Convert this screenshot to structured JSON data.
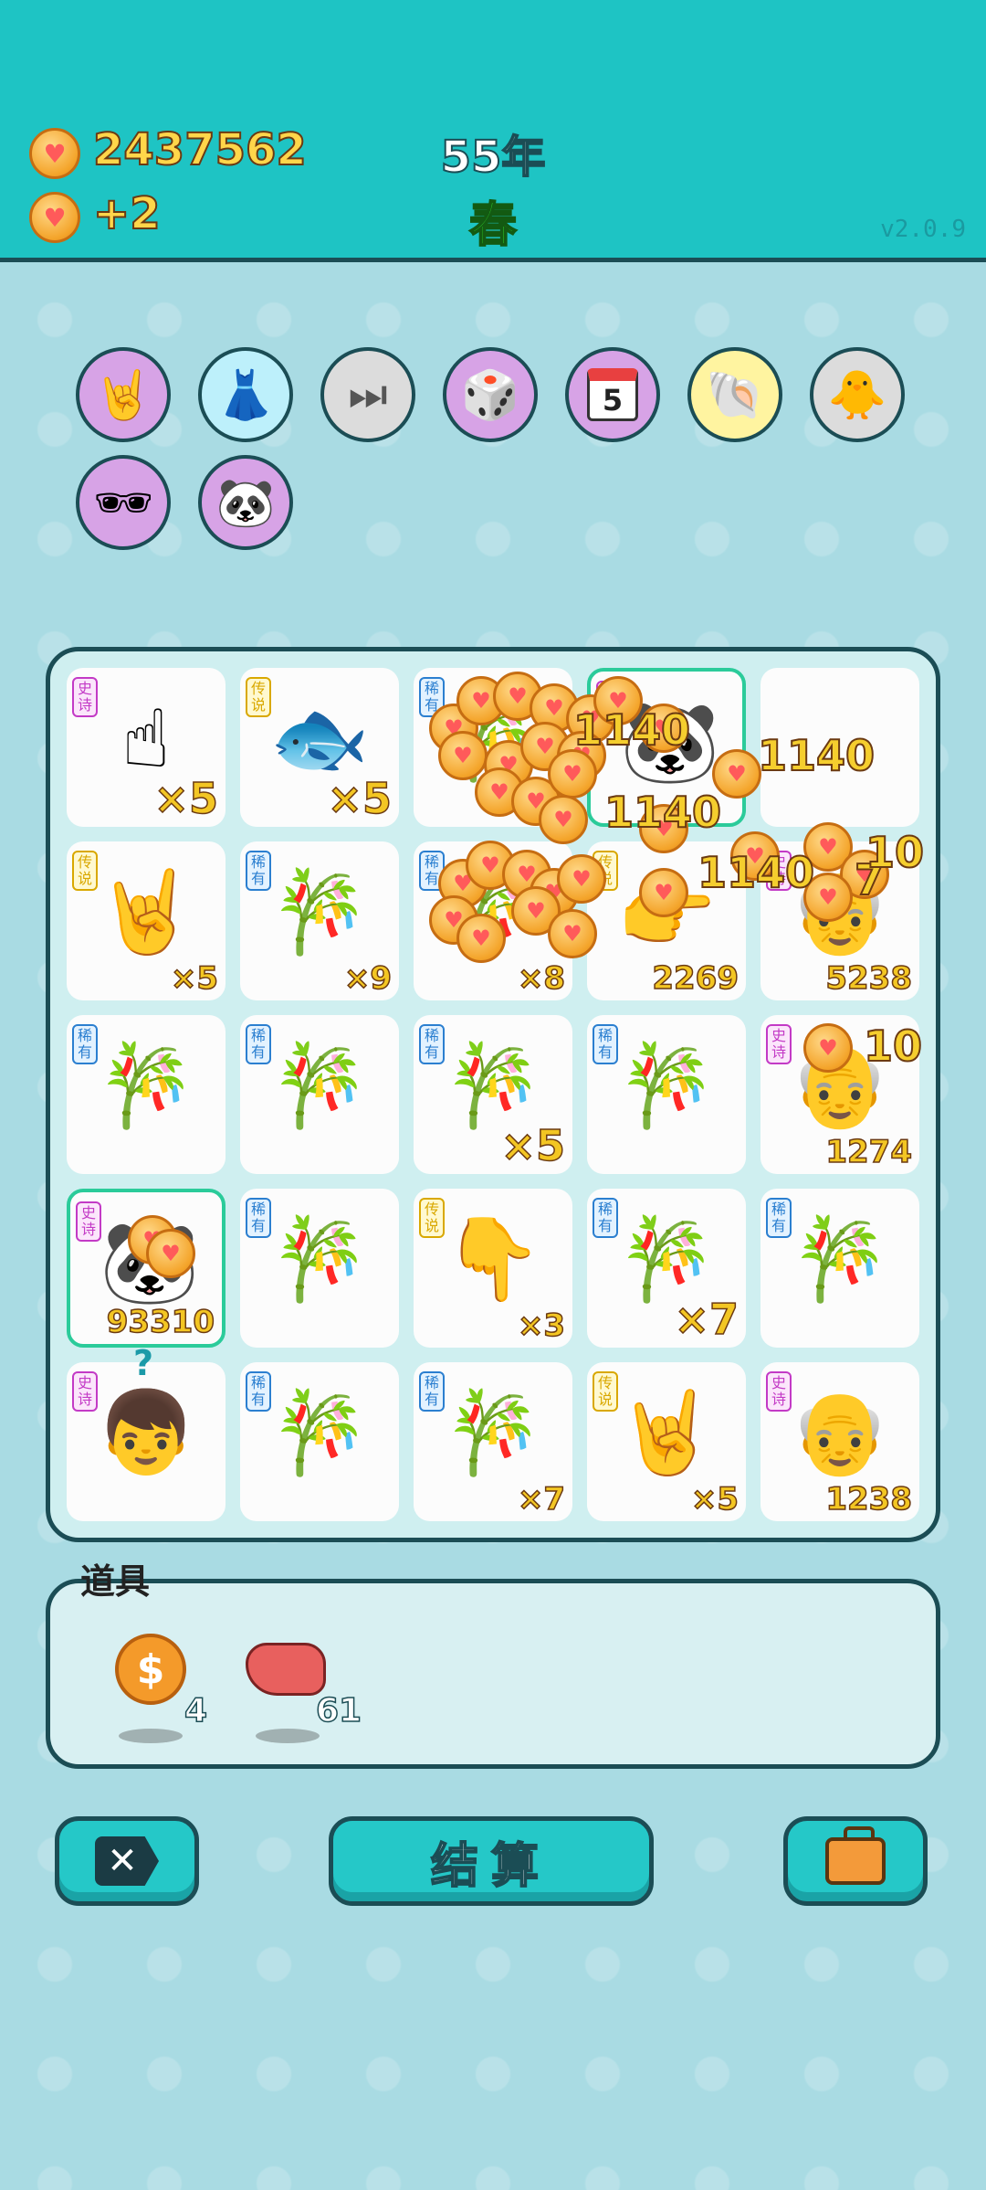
{
  "header": {
    "coins": "2437562",
    "coins_per_turn": "+2",
    "year": "55年",
    "season": "春",
    "version": "v2.0.9"
  },
  "relics": [
    {
      "icon": "rock-hand-icon",
      "bg": "#d7a3e6"
    },
    {
      "icon": "skirt-icon",
      "bg": "#bdf0fb"
    },
    {
      "icon": "skip-arrow-icon",
      "bg": "#dcdcdc"
    },
    {
      "icon": "dice-bag-icon",
      "bg": "#d7a3e6"
    },
    {
      "icon": "calendar-icon",
      "calendar_day": "5",
      "bg": "#d7a3e6"
    },
    {
      "icon": "shell-icon",
      "bg": "#fff4a0"
    },
    {
      "icon": "chick-egg-icon",
      "bg": "#dcdcdc"
    },
    {
      "icon": "sunglasses-gold-icon",
      "bg": "#d7a3e6"
    },
    {
      "icon": "panda-icon",
      "bg": "#d7a3e6"
    }
  ],
  "board": {
    "cells": [
      {
        "tag": "史诗",
        "rarity": "epic",
        "icon": "gray-pointing-hand-icon",
        "glyph": "☝",
        "count": "×5",
        "big": true
      },
      {
        "tag": "传说",
        "rarity": "legend",
        "icon": "koi-fish-icon",
        "glyph": "🐟",
        "count": "×5",
        "big": true
      },
      {
        "tag": "稀有",
        "rarity": "rare",
        "icon": "bamboo-icon",
        "glyph": "🎋",
        "count": "",
        "big": false
      },
      {
        "tag": "史诗",
        "rarity": "epic",
        "icon": "panda-icon",
        "glyph": "🐼",
        "count": "",
        "big": false,
        "selected": true
      },
      {
        "tag": "",
        "rarity": "",
        "icon": "",
        "glyph": "",
        "count": "",
        "big": false
      },
      {
        "tag": "传说",
        "rarity": "legend",
        "icon": "rock-hand-icon",
        "glyph": "🤘",
        "count": "×5",
        "big": false
      },
      {
        "tag": "稀有",
        "rarity": "rare",
        "icon": "bamboo-icon",
        "glyph": "🎋",
        "count": "×9",
        "big": false
      },
      {
        "tag": "稀有",
        "rarity": "rare",
        "icon": "bamboo-icon",
        "glyph": "🎋",
        "count": "×8",
        "big": false
      },
      {
        "tag": "传说",
        "rarity": "legend",
        "icon": "yellow-pointing-hand-icon",
        "glyph": "👉",
        "count": "2269",
        "big": false
      },
      {
        "tag": "史诗",
        "rarity": "epic",
        "icon": "bearded-man-icon",
        "glyph": "👴",
        "count": "5238",
        "big": false
      },
      {
        "tag": "稀有",
        "rarity": "rare",
        "icon": "bamboo-icon",
        "glyph": "🎋",
        "count": "",
        "big": false
      },
      {
        "tag": "稀有",
        "rarity": "rare",
        "icon": "bamboo-icon",
        "glyph": "🎋",
        "count": "",
        "big": false
      },
      {
        "tag": "稀有",
        "rarity": "rare",
        "icon": "bamboo-icon",
        "glyph": "🎋",
        "count": "×5",
        "big": true
      },
      {
        "tag": "稀有",
        "rarity": "rare",
        "icon": "bamboo-icon",
        "glyph": "🎋",
        "count": "",
        "big": false
      },
      {
        "tag": "史诗",
        "rarity": "epic",
        "icon": "green-hat-man-icon",
        "glyph": "👴",
        "count": "1274",
        "big": false
      },
      {
        "tag": "史诗",
        "rarity": "epic",
        "icon": "panda-icon",
        "glyph": "🐼",
        "count": "93310",
        "big": false,
        "selected": true
      },
      {
        "tag": "稀有",
        "rarity": "rare",
        "icon": "bamboo-icon",
        "glyph": "🎋",
        "count": "",
        "big": false
      },
      {
        "tag": "传说",
        "rarity": "legend",
        "icon": "yellow-pointing-hand-icon",
        "glyph": "👇",
        "count": "×3",
        "big": false
      },
      {
        "tag": "稀有",
        "rarity": "rare",
        "icon": "bamboo-icon",
        "glyph": "🎋",
        "count": "×7",
        "big": true
      },
      {
        "tag": "稀有",
        "rarity": "rare",
        "icon": "bamboo-icon",
        "glyph": "🎋",
        "count": "",
        "big": false
      },
      {
        "tag": "史诗",
        "rarity": "epic",
        "icon": "red-cap-boy-icon",
        "glyph": "👦",
        "count": "",
        "big": false
      },
      {
        "tag": "稀有",
        "rarity": "rare",
        "icon": "bamboo-icon",
        "glyph": "🎋",
        "count": "",
        "big": false
      },
      {
        "tag": "稀有",
        "rarity": "rare",
        "icon": "bamboo-icon",
        "glyph": "🎋",
        "count": "×7",
        "big": false
      },
      {
        "tag": "传说",
        "rarity": "legend",
        "icon": "rock-hand-icon",
        "glyph": "🤘",
        "count": "×5",
        "big": false
      },
      {
        "tag": "史诗",
        "rarity": "epic",
        "icon": "green-hat-man-icon",
        "glyph": "👴",
        "count": "1238",
        "big": false
      }
    ],
    "question_mark": "?",
    "floating_numbers": [
      "1140",
      "1140",
      "1140",
      "1140",
      "7",
      "10",
      "10"
    ]
  },
  "items": {
    "label": "道具",
    "list": [
      {
        "icon": "coin-dollar-icon",
        "count": "4"
      },
      {
        "icon": "liver-icon",
        "count": "61"
      }
    ]
  },
  "buttons": {
    "close_icon": "close-icon",
    "settle_label": "结算",
    "briefcase_icon": "briefcase-icon"
  },
  "colors": {
    "header_bg": "#1ec4c4",
    "page_bg": "#a9dbe3",
    "coin_text": "#ffd64a",
    "season_text": "#31d12b"
  }
}
